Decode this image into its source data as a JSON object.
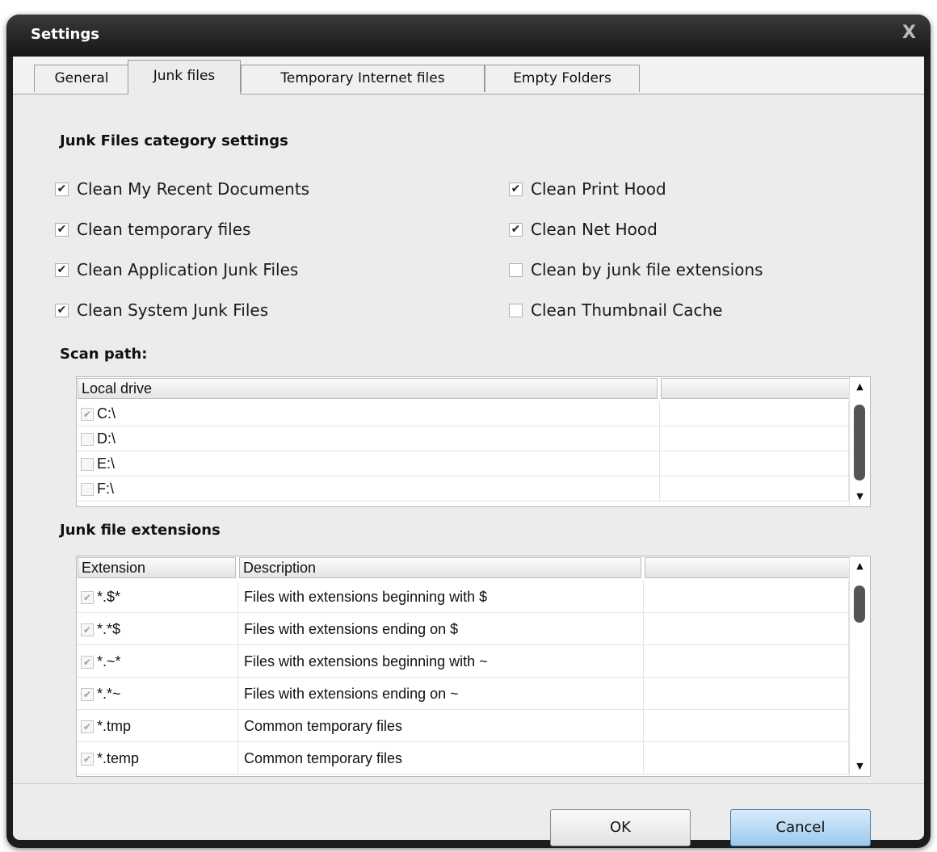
{
  "window": {
    "title": "Settings",
    "close_glyph": "X"
  },
  "tabs": [
    {
      "label": "General",
      "active": false
    },
    {
      "label": "Junk files",
      "active": true
    },
    {
      "label": "Temporary Internet files",
      "active": false
    },
    {
      "label": "Empty Folders",
      "active": false
    }
  ],
  "junk_settings": {
    "heading": "Junk Files category settings",
    "options": [
      {
        "label": "Clean My Recent Documents",
        "checked": true
      },
      {
        "label": "Clean temporary files",
        "checked": true
      },
      {
        "label": "Clean Application Junk Files",
        "checked": true
      },
      {
        "label": "Clean System Junk Files",
        "checked": true
      },
      {
        "label": "Clean Print Hood",
        "checked": true
      },
      {
        "label": "Clean Net Hood",
        "checked": true
      },
      {
        "label": "Clean by junk file extensions",
        "checked": false
      },
      {
        "label": "Clean Thumbnail Cache",
        "checked": false
      }
    ]
  },
  "scan_path": {
    "heading": "Scan path:",
    "columns": [
      "Local drive",
      ""
    ],
    "rows": [
      {
        "drive": "C:\\",
        "checked": true
      },
      {
        "drive": "D:\\",
        "checked": false
      },
      {
        "drive": "E:\\",
        "checked": false
      },
      {
        "drive": "F:\\",
        "checked": false
      }
    ]
  },
  "extensions": {
    "heading": "Junk file extensions",
    "columns": [
      "Extension",
      "Description",
      ""
    ],
    "rows": [
      {
        "ext": "*.$*",
        "desc": "Files with extensions beginning with $",
        "checked": true
      },
      {
        "ext": "*.*$",
        "desc": "Files with extensions ending on $",
        "checked": true
      },
      {
        "ext": "*.~*",
        "desc": "Files with extensions beginning with ~",
        "checked": true
      },
      {
        "ext": "*.*~",
        "desc": "Files with extensions ending on ~",
        "checked": true
      },
      {
        "ext": "*.tmp",
        "desc": "Common temporary files",
        "checked": true
      },
      {
        "ext": "*.temp",
        "desc": "Common temporary files",
        "checked": true
      }
    ]
  },
  "buttons": {
    "ok": "OK",
    "cancel": "Cancel"
  },
  "colors": {
    "title_bar": "#1c1c1c",
    "client_bg": "#ececec",
    "cancel_accent": "#9cc8ec",
    "scroll_thumb": "#555555"
  }
}
